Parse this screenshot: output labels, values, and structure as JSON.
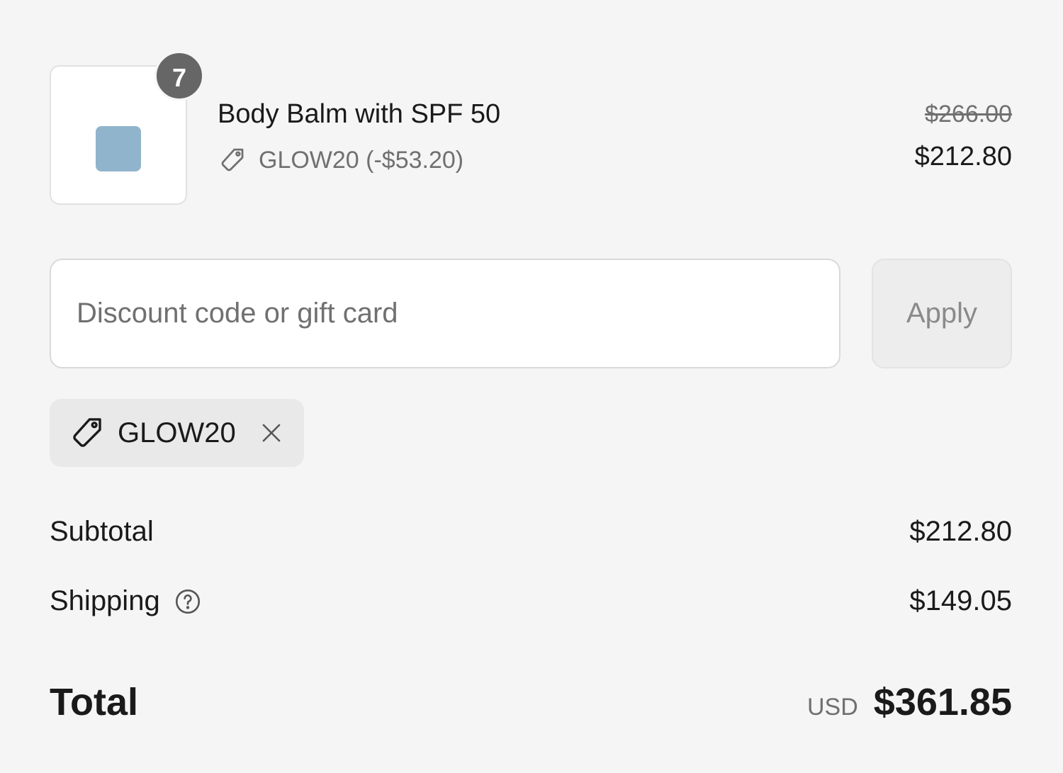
{
  "line_item": {
    "quantity": "7",
    "title": "Body Balm with SPF 50",
    "discount_label": "GLOW20 (-$53.20)",
    "original_price": "$266.00",
    "price": "$212.80",
    "thumbnail_color": "#91b4cd"
  },
  "discount_form": {
    "placeholder": "Discount code or gift card",
    "value": "",
    "apply_label": "Apply"
  },
  "applied_code": {
    "code": "GLOW20"
  },
  "totals": {
    "subtotal_label": "Subtotal",
    "subtotal_value": "$212.80",
    "shipping_label": "Shipping",
    "shipping_value": "$149.05",
    "total_label": "Total",
    "currency": "USD",
    "total_value": "$361.85"
  }
}
